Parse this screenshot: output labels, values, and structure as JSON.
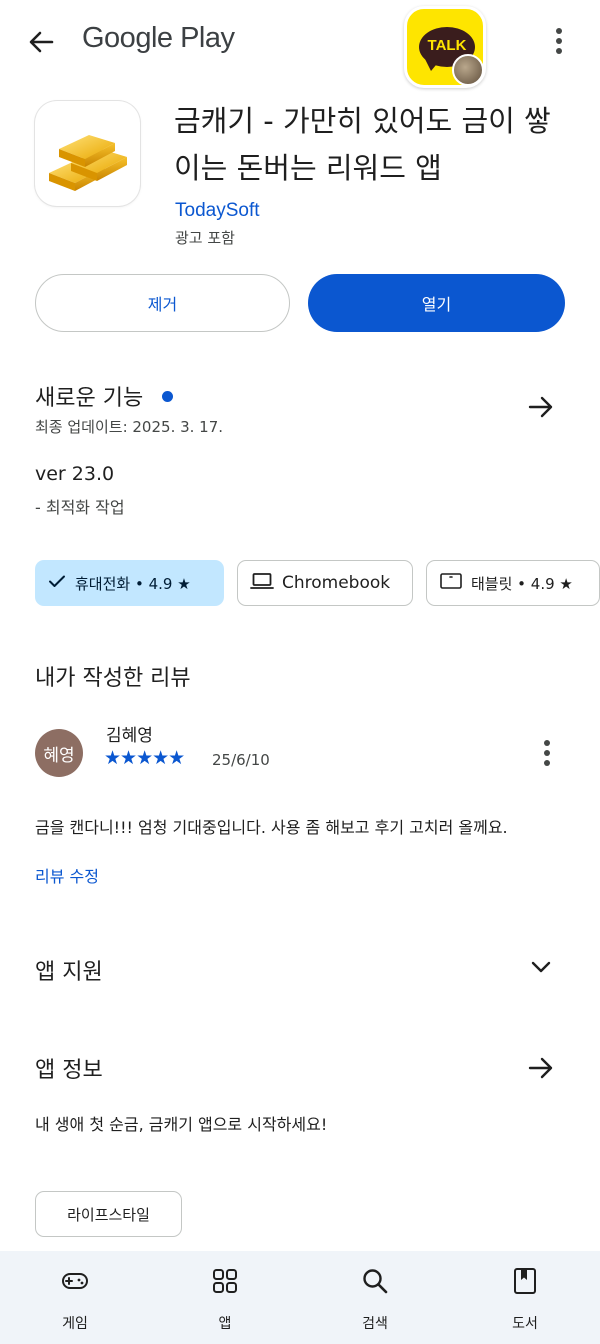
{
  "top_bar": {
    "store_name": "Google Play",
    "notification_app": "TALK"
  },
  "app": {
    "title": "금캐기 - 가만히 있어도 금이 쌓이는 돈버는 리워드 앱",
    "developer": "TodaySoft",
    "ads_label": "광고 포함",
    "remove_label": "제거",
    "open_label": "열기"
  },
  "whats_new": {
    "title": "새로운 기능",
    "updated": "최종 업데이트: 2025. 3. 17.",
    "version": "ver 23.0",
    "note": "- 최적화 작업"
  },
  "devices": {
    "phone": "휴대전화 • 4.9 ★",
    "chromebook": "Chromebook",
    "tablet": "태블릿 • 4.9 ★"
  },
  "review": {
    "section_title": "내가 작성한 리뷰",
    "avatar_text": "혜영",
    "reviewer": "김혜영",
    "stars": "★★★★★",
    "rating": 5,
    "date": "25/6/10",
    "text": "금을 캔다니!!! 엄청 기대중입니다. 사용 좀 해보고 후기 고치러 올께요.",
    "edit_label": "리뷰 수정"
  },
  "support": {
    "title": "앱 지원"
  },
  "info": {
    "title": "앱 정보",
    "description": "내 생애 첫 순금, 금캐기 앱으로 시작하세요!",
    "tag": "라이프스타일"
  },
  "nav": {
    "games": "게임",
    "apps": "앱",
    "search": "검색",
    "books": "도서"
  },
  "colors": {
    "accent": "#0b57d0",
    "chip_selected": "#c2e7ff",
    "nav_bg": "#f0f4f9",
    "talk_yellow": "#fee500"
  }
}
